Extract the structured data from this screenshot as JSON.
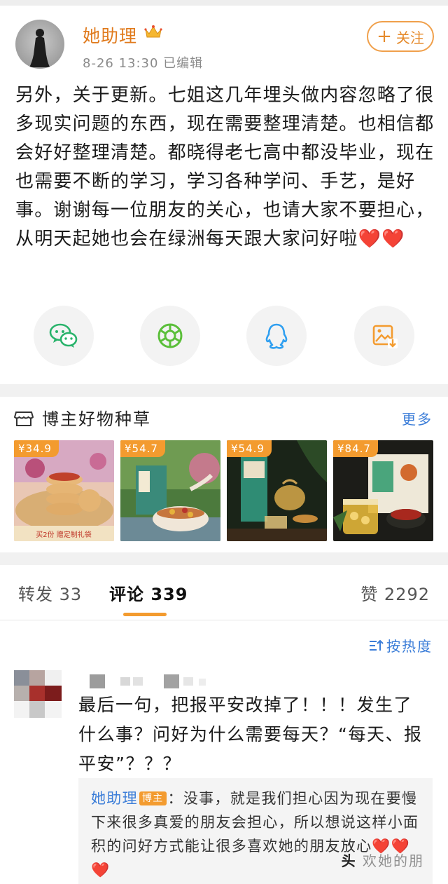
{
  "post": {
    "author": "她助理",
    "meta": "8-26 13:30  已编辑",
    "follow_label": "关注",
    "body": "另外，关于更新。七姐这几年埋头做内容忽略了很多现实问题的东西，现在需要整理清楚。也相信都会好好整理清楚。都晓得老七高中都没毕业，现在也需要不断的学习，学习各种学问、手艺，是好事。谢谢每一位朋友的关心，也请大家不要担心，从明天起她也会在绿洲每天跟大家问好啦",
    "body_hearts": "❤️❤️"
  },
  "share": [
    {
      "icon": "wechat-icon"
    },
    {
      "icon": "moments-icon"
    },
    {
      "icon": "qq-icon"
    },
    {
      "icon": "save-image-icon"
    }
  ],
  "products": {
    "title": "博主好物种草",
    "more": "更多",
    "items": [
      {
        "price": "¥34.9",
        "caption": "买2份 赠定制礼袋"
      },
      {
        "price": "¥54.7"
      },
      {
        "price": "¥54.9"
      },
      {
        "price": "¥84.7"
      }
    ]
  },
  "tabs": {
    "repost": "转发 33",
    "comment": "评论 339",
    "like": "赞 2292"
  },
  "sort_label": "按热度",
  "comment": {
    "text": "最后一句，把报平安改掉了！！！发生了什么事？问好为什么需要每天？“每天、报平安”？？？",
    "reply": {
      "author": "她助理",
      "badge": "博主",
      "text": "：没事，就是我们担心因为现在要慢下来很多真爱的朋友会担心，所以想说这样小面积的问好方式能让很多喜欢她的朋友放心",
      "hearts": "❤️❤️❤️"
    }
  },
  "watermark": {
    "logo": "头",
    "text": "欢她的朋"
  },
  "colors": {
    "accent": "#f39b2f",
    "author": "#e07a1c",
    "link": "#3b7dd8"
  }
}
